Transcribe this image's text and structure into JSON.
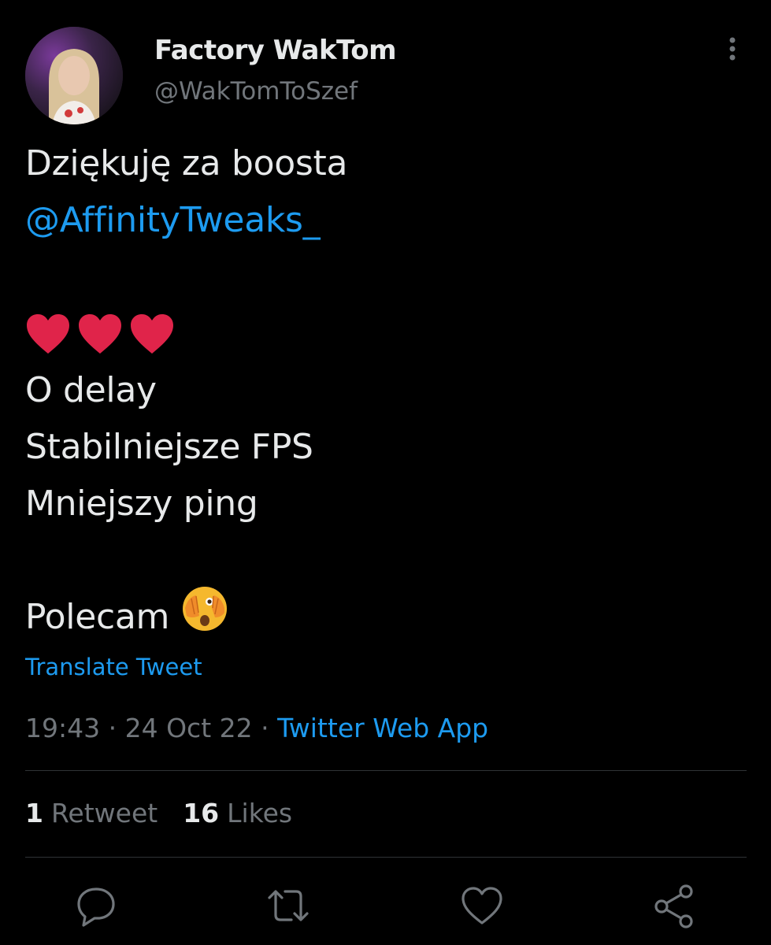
{
  "user": {
    "display_name": "Factory WakTom",
    "handle": "@WakTomToSzef",
    "avatar_icon": "avatar-photo"
  },
  "more_icon": "more-vertical-icon",
  "tweet": {
    "line1": "Dziękuję za boosta",
    "mention": "@AffinityTweaks_",
    "hearts_emoji": "❤️❤️❤️",
    "line_delay": "O delay",
    "line_fps": "Stabilniejsze FPS",
    "line_ping": "Mniejszy ping",
    "line_polecam": "Polecam",
    "face_emoji": "🫣"
  },
  "translate_label": "Translate Tweet",
  "meta": {
    "time": "19:43",
    "separator": " · ",
    "date": "24 Oct 22",
    "source": "Twitter Web App"
  },
  "stats": {
    "retweets_count": "1",
    "retweets_label": "Retweet",
    "likes_count": "16",
    "likes_label": "Likes"
  },
  "actions": {
    "reply_icon": "reply-icon",
    "retweet_icon": "retweet-icon",
    "like_icon": "like-icon",
    "share_icon": "share-icon"
  },
  "colors": {
    "background": "#000000",
    "text": "#e7e9ea",
    "secondary": "#71767b",
    "accent": "#1d9bf0",
    "heart": "#e0244a",
    "divider": "#2f3336"
  }
}
